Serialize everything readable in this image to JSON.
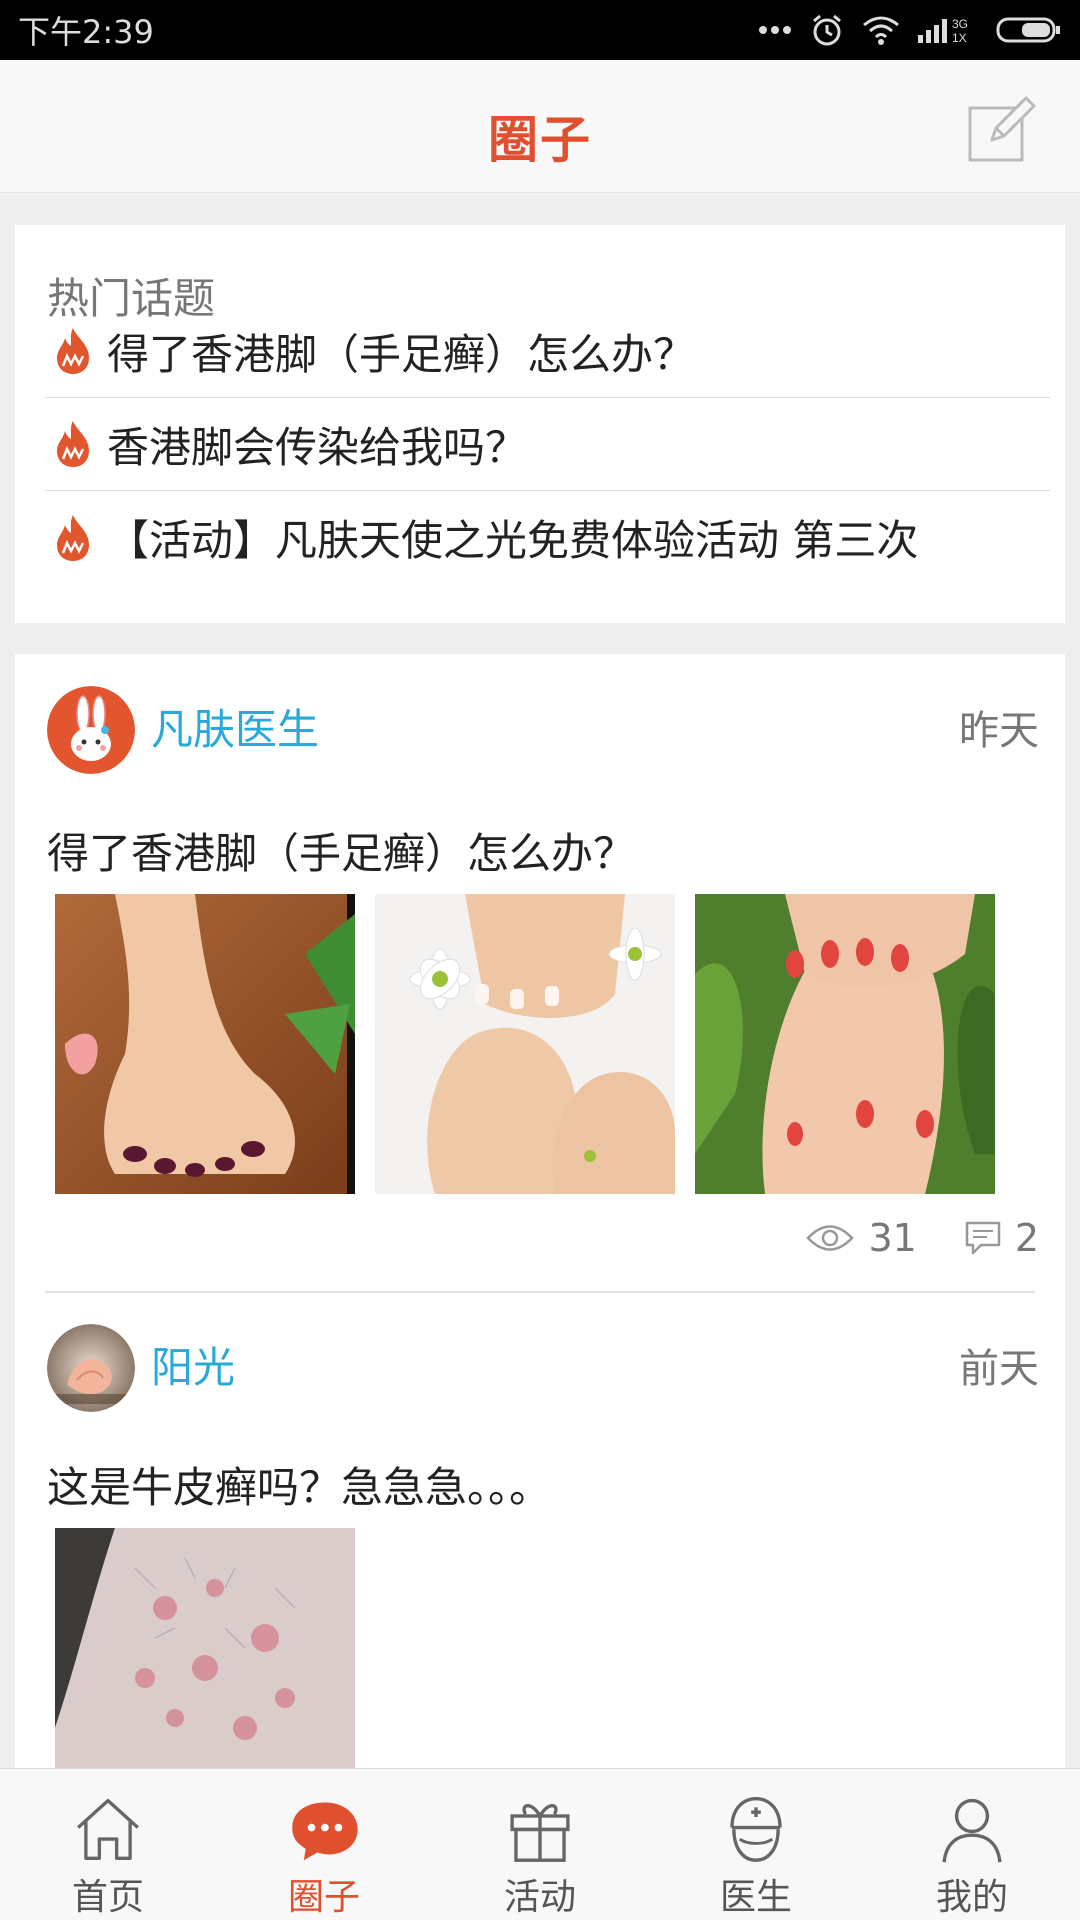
{
  "status_bar": {
    "time": "下午2:39",
    "network": "3G\n1X"
  },
  "header": {
    "title": "圈子"
  },
  "hot_topics": {
    "heading": "热门话题",
    "items": [
      {
        "text": "得了香港脚（手足癣）怎么办？"
      },
      {
        "text": " 香港脚会传染给我吗？"
      },
      {
        "text": "【活动】凡肤天使之光免费体验活动 第三次"
      }
    ]
  },
  "posts": [
    {
      "author": "凡肤医生",
      "time": "昨天",
      "text": "得了香港脚（手足癣）怎么办？",
      "views": "31",
      "comments": "2"
    },
    {
      "author": "阳光",
      "time": "前天",
      "text": "这是牛皮癣吗？急急急。。。"
    }
  ],
  "bottom_nav": {
    "items": [
      {
        "label": "首页",
        "icon": "home-icon"
      },
      {
        "label": "圈子",
        "icon": "chat-bubble-icon"
      },
      {
        "label": "活动",
        "icon": "gift-icon"
      },
      {
        "label": "医生",
        "icon": "doctor-icon"
      },
      {
        "label": "我的",
        "icon": "person-icon"
      }
    ],
    "active_index": 1
  },
  "colors": {
    "accent": "#e0502f",
    "author_link": "#29a9d8",
    "background": "#efefef"
  }
}
